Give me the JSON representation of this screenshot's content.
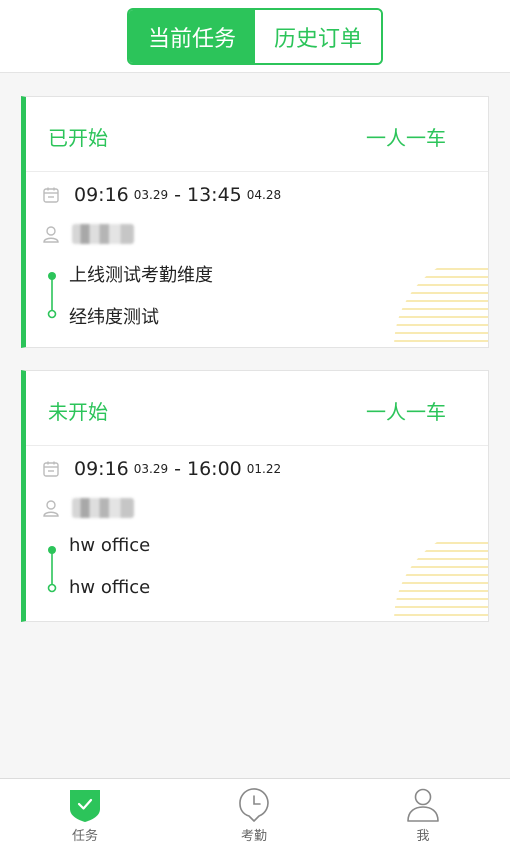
{
  "segment": {
    "tabs": [
      {
        "label": "当前任务",
        "active": true
      },
      {
        "label": "历史订单",
        "active": false
      }
    ]
  },
  "cards": [
    {
      "status": "已开始",
      "type": "一人一车",
      "start_time": "09:16",
      "start_date": "03.29",
      "separator": "-",
      "end_time": "13:45",
      "end_date": "04.28",
      "from": "上线测试考勤维度",
      "to": "经纬度测试"
    },
    {
      "status": "未开始",
      "type": "一人一车",
      "start_time": "09:16",
      "start_date": "03.29",
      "separator": "-",
      "end_time": "16:00",
      "end_date": "01.22",
      "from": "hw office",
      "to": "hw office"
    }
  ],
  "tabbar": {
    "tabs": [
      {
        "label": "任务",
        "icon": "task-shield-icon",
        "active": true
      },
      {
        "label": "考勤",
        "icon": "clock-pin-icon",
        "active": false
      },
      {
        "label": "我",
        "icon": "person-icon",
        "active": false
      }
    ]
  },
  "colors": {
    "accent": "#2cc45a",
    "deco": "#f5e39a"
  }
}
